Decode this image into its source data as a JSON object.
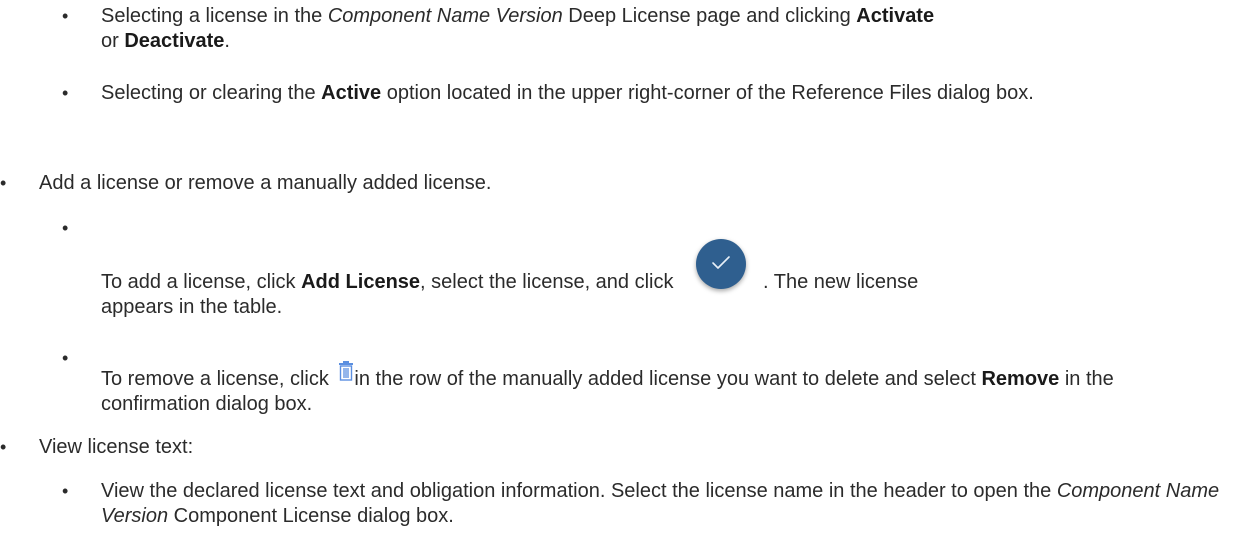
{
  "items": [
    {
      "level": 2,
      "bullet": "•",
      "parts": [
        "Selecting a license in the ",
        "Component Name Version",
        " Deep License page and clicking ",
        "Activate",
        " or ",
        "Deactivate",
        "."
      ]
    },
    {
      "level": 2,
      "bullet": "•",
      "parts": [
        "Selecting or clearing the ",
        "Active",
        " option located in the upper right-corner of the Reference Files dialog box."
      ]
    },
    {
      "level": 1,
      "bullet": "•",
      "text": "Add a license or remove a manually added license."
    },
    {
      "level": 2,
      "bullet": "•",
      "parts": [
        "To add a license, click ",
        "Add License",
        ", select the license, and click ",
        ". The new license appears in the table."
      ]
    },
    {
      "level": 2,
      "bullet": "•",
      "parts": [
        "To remove a license, click ",
        "in the row of the manually added license you want to delete and select ",
        "Remove",
        " in the confirmation dialog box."
      ]
    },
    {
      "level": 1,
      "bullet": "•",
      "text": "View license text:"
    },
    {
      "level": 2,
      "bullet": "•",
      "parts": [
        "View the declared license text and obligation information. Select the license name in the header to open the ",
        "Component Name Version",
        " Component License dialog box."
      ]
    }
  ],
  "icons": {
    "confirm_button": "check-icon",
    "delete_icon": "trash-icon",
    "confirm_button_color": "#2f5f8f",
    "delete_icon_color": "#5b8fe0"
  }
}
